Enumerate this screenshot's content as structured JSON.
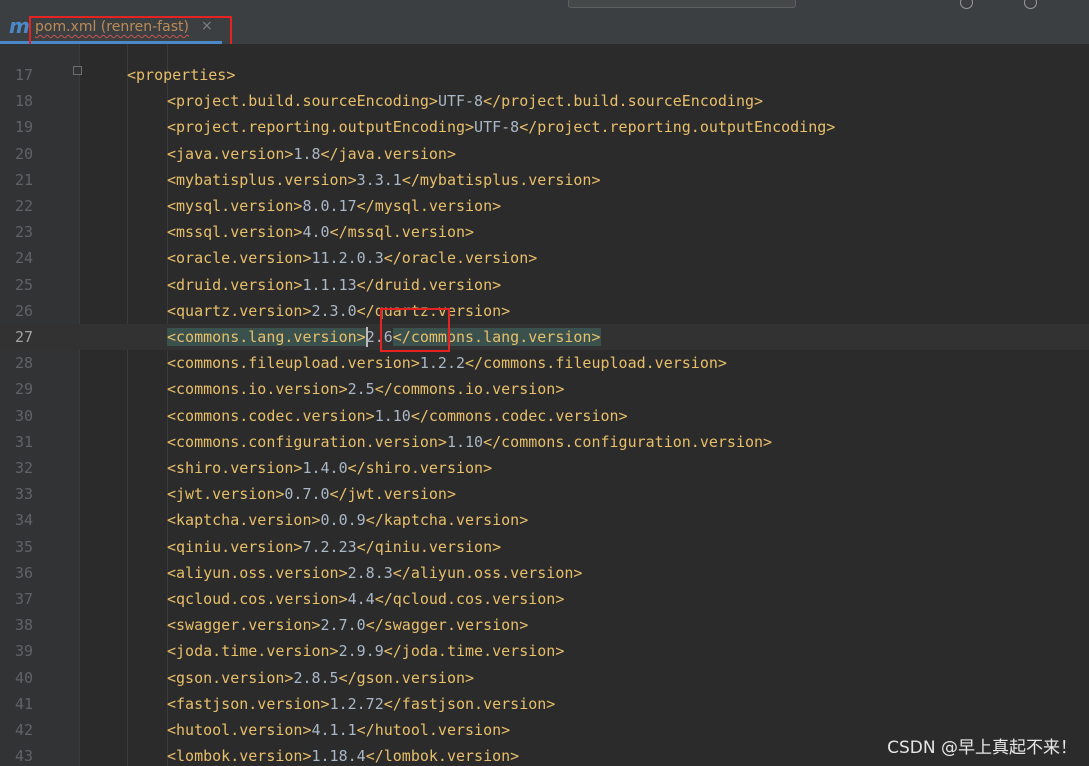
{
  "tab": {
    "icon": "maven-m-icon",
    "icon_text": "m",
    "label": "pom.xml (renren-fast)",
    "close_glyph": "×"
  },
  "editor": {
    "current_line": 27,
    "partial_top_line": "16",
    "lines": [
      {
        "num": "17",
        "indent": 0,
        "open": "<properties>",
        "value": "",
        "close": ""
      },
      {
        "num": "18",
        "indent": 1,
        "open": "<project.build.sourceEncoding>",
        "value": "UTF-8",
        "close": "</project.build.sourceEncoding>"
      },
      {
        "num": "19",
        "indent": 1,
        "open": "<project.reporting.outputEncoding>",
        "value": "UTF-8",
        "close": "</project.reporting.outputEncoding>"
      },
      {
        "num": "20",
        "indent": 1,
        "open": "<java.version>",
        "value": "1.8",
        "close": "</java.version>"
      },
      {
        "num": "21",
        "indent": 1,
        "open": "<mybatisplus.version>",
        "value": "3.3.1",
        "close": "</mybatisplus.version>"
      },
      {
        "num": "22",
        "indent": 1,
        "open": "<mysql.version>",
        "value": "8.0.17",
        "close": "</mysql.version>"
      },
      {
        "num": "23",
        "indent": 1,
        "open": "<mssql.version>",
        "value": "4.0",
        "close": "</mssql.version>"
      },
      {
        "num": "24",
        "indent": 1,
        "open": "<oracle.version>",
        "value": "11.2.0.3",
        "close": "</oracle.version>"
      },
      {
        "num": "25",
        "indent": 1,
        "open": "<druid.version>",
        "value": "1.1.13",
        "close": "</druid.version>"
      },
      {
        "num": "26",
        "indent": 1,
        "open": "<quartz.version>",
        "value": "2.3.0",
        "close": "</quartz.version>"
      },
      {
        "num": "27",
        "indent": 1,
        "open": "<commons.lang.version>",
        "value": "2.6",
        "close": "</commons.lang.version>"
      },
      {
        "num": "28",
        "indent": 1,
        "open": "<commons.fileupload.version>",
        "value": "1.2.2",
        "close": "</commons.fileupload.version>"
      },
      {
        "num": "29",
        "indent": 1,
        "open": "<commons.io.version>",
        "value": "2.5",
        "close": "</commons.io.version>"
      },
      {
        "num": "30",
        "indent": 1,
        "open": "<commons.codec.version>",
        "value": "1.10",
        "close": "</commons.codec.version>"
      },
      {
        "num": "31",
        "indent": 1,
        "open": "<commons.configuration.version>",
        "value": "1.10",
        "close": "</commons.configuration.version>"
      },
      {
        "num": "32",
        "indent": 1,
        "open": "<shiro.version>",
        "value": "1.4.0",
        "close": "</shiro.version>"
      },
      {
        "num": "33",
        "indent": 1,
        "open": "<jwt.version>",
        "value": "0.7.0",
        "close": "</jwt.version>"
      },
      {
        "num": "34",
        "indent": 1,
        "open": "<kaptcha.version>",
        "value": "0.0.9",
        "close": "</kaptcha.version>"
      },
      {
        "num": "35",
        "indent": 1,
        "open": "<qiniu.version>",
        "value": "7.2.23",
        "close": "</qiniu.version>"
      },
      {
        "num": "36",
        "indent": 1,
        "open": "<aliyun.oss.version>",
        "value": "2.8.3",
        "close": "</aliyun.oss.version>"
      },
      {
        "num": "37",
        "indent": 1,
        "open": "<qcloud.cos.version>",
        "value": "4.4",
        "close": "</qcloud.cos.version>"
      },
      {
        "num": "38",
        "indent": 1,
        "open": "<swagger.version>",
        "value": "2.7.0",
        "close": "</swagger.version>"
      },
      {
        "num": "39",
        "indent": 1,
        "open": "<joda.time.version>",
        "value": "2.9.9",
        "close": "</joda.time.version>"
      },
      {
        "num": "40",
        "indent": 1,
        "open": "<gson.version>",
        "value": "2.8.5",
        "close": "</gson.version>"
      },
      {
        "num": "41",
        "indent": 1,
        "open": "<fastjson.version>",
        "value": "1.2.72",
        "close": "</fastjson.version>"
      },
      {
        "num": "42",
        "indent": 1,
        "open": "<hutool.version>",
        "value": "4.1.1",
        "close": "</hutool.version>"
      },
      {
        "num": "43",
        "indent": 1,
        "open": "<lombok.version>",
        "value": "1.18.4",
        "close": "</lombok.version>"
      }
    ]
  },
  "watermark": "CSDN @早上真起不来！",
  "colors": {
    "tag": "#e8bf6a",
    "value": "#a9b7c6",
    "line_number": "#606366",
    "annotation_box": "#e52323",
    "tab_label": "#bd8b57"
  }
}
